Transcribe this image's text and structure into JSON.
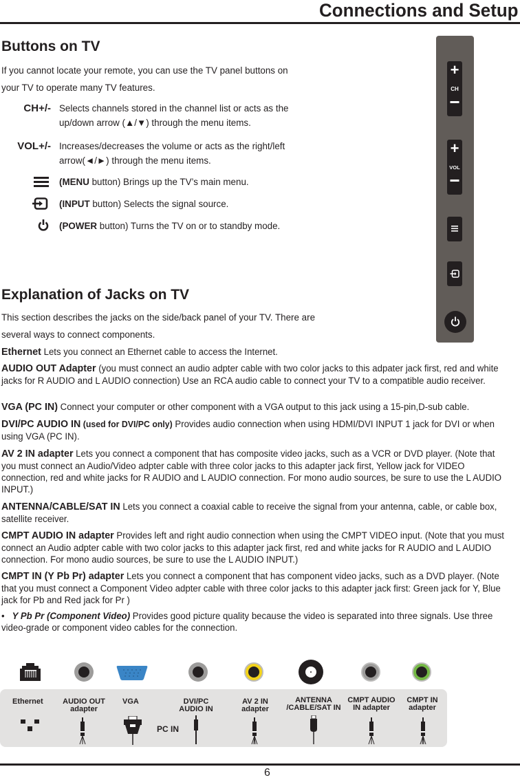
{
  "header": {
    "title": "Connections and Setup"
  },
  "buttons_section": {
    "heading": "Buttons on TV",
    "intro_line1": "If you cannot locate your remote, you can use the TV panel buttons on",
    "intro_line2": "your TV to operate many TV features.",
    "items": [
      {
        "key": "CH+/-",
        "desc_line1": "Selects channels stored in the channel list or acts as the",
        "desc_line2": "up/down arrow (▲/▼) through the menu items."
      },
      {
        "key": "VOL+/-",
        "desc_line1": "Increases/decreases the volume or acts as the right/left",
        "desc_line2": "arrow(◄/►) through the menu items."
      },
      {
        "icon": "menu-icon",
        "bold": "(MENU",
        "rest": " button) Brings up the TV’s main menu."
      },
      {
        "icon": "input-icon",
        "bold": "(INPUT",
        "rest": " button) Selects the signal source."
      },
      {
        "icon": "power-icon",
        "bold": "(POWER",
        "rest": " button) Turns the TV on or to standby mode."
      }
    ]
  },
  "tv_panel": {
    "ch_label": "CH",
    "vol_label": "VOL",
    "plus": "+",
    "minus": "—"
  },
  "jacks_section": {
    "heading": "Explanation of Jacks on TV",
    "intro_line1": "This section describes the jacks on the side/back panel of your TV. There are",
    "intro_line2": "several ways to connect components.",
    "items": [
      {
        "name": "Ethernet",
        "text": "  Lets you connect an Ethernet cable to access the Internet."
      },
      {
        "name": "AUDIO OUT Adapter",
        "text": "  (you must connect an audio adpter cable with two color jacks to this adpater jack first, red and white jacks for R AUDIO and L AUDIO connection) Use an RCA audio cable to connect your TV to a compatible audio receiver."
      },
      {
        "name": "VGA (PC IN)",
        "text": " Connect your computer or other component with a VGA output to this jack using a 15-pin,D-sub cable."
      },
      {
        "name": "DVI/PC AUDIO IN",
        "sub": " (used for DVI/PC only)",
        "text": " Provides audio connection when using HDMI/DVI INPUT 1 jack for DVI or when using VGA (PC IN)."
      },
      {
        "name": "AV 2 IN adapter",
        "text": " Lets you connect a component that has composite video jacks, such as a VCR or DVD player. (Note that you must connect an Audio/Video adpter cable with three color jacks to this adapter jack first, Yellow jack for VIDEO connection, red and white jacks for R AUDIO and L AUDIO connection. For mono audio sources, be sure to use the L AUDIO INPUT.)"
      },
      {
        "name": "ANTENNA/CABLE/SAT IN",
        "text": "  Lets you connect a coaxial cable to receive the signal from your antenna, cable, or cable box, satellite receiver."
      },
      {
        "name": "CMPT AUDIO IN adapter",
        "text": "  Provides left and right audio connection when using the CMPT VIDEO input. (Note that you must connect an Audio adpter cable with two color jacks to this adapter jack first, red and white jacks for R AUDIO and L AUDIO connection. For mono audio sources, be sure to use the L AUDIO INPUT.)"
      },
      {
        "name": "CMPT IN (Y Pb Pr) adapter",
        "text": "  Lets you connect a component that has component video jacks, such as a DVD player. (Note that you must connect a Component Video adpter cable with three color jacks to this adapter jack first: Green jack for Y, Blue jack for Pb and Red jack for Pr )"
      }
    ],
    "bullet": {
      "mark": "•",
      "name": "Y Pb Pr (Component Video)",
      "text": " Provides good picture quality because the video is separated into three signals. Use three video-grade or component video cables for the connection."
    }
  },
  "jack_panel": {
    "labels": {
      "ethernet": "Ethernet",
      "audio_out_1": "AUDIO OUT",
      "audio_out_2": "adapter",
      "vga": "VGA",
      "dvi_1": "DVI/PC",
      "dvi_2": "AUDIO IN",
      "pc_in": "PC IN",
      "av2_1": "AV 2 IN",
      "av2_2": "adapter",
      "ant_1": "ANTENNA",
      "ant_2": "/CABLE/SAT IN",
      "cmpt_audio_1": "CMPT AUDIO",
      "cmpt_audio_2": "IN adapter",
      "cmpt_in_1": "CMPT IN",
      "cmpt_in_2": "adapter"
    },
    "colors": {
      "audio_ring": "#9d9c9b",
      "vga": "#3a85c6",
      "av2_ring": "#f2d21b",
      "antenna": "#231f20",
      "cmpt_audio_ring": "#9d9c9b",
      "cmpt_in_ring": "#74b845",
      "strip": "#e3e2e1"
    }
  },
  "footer": {
    "page_number": "6"
  }
}
